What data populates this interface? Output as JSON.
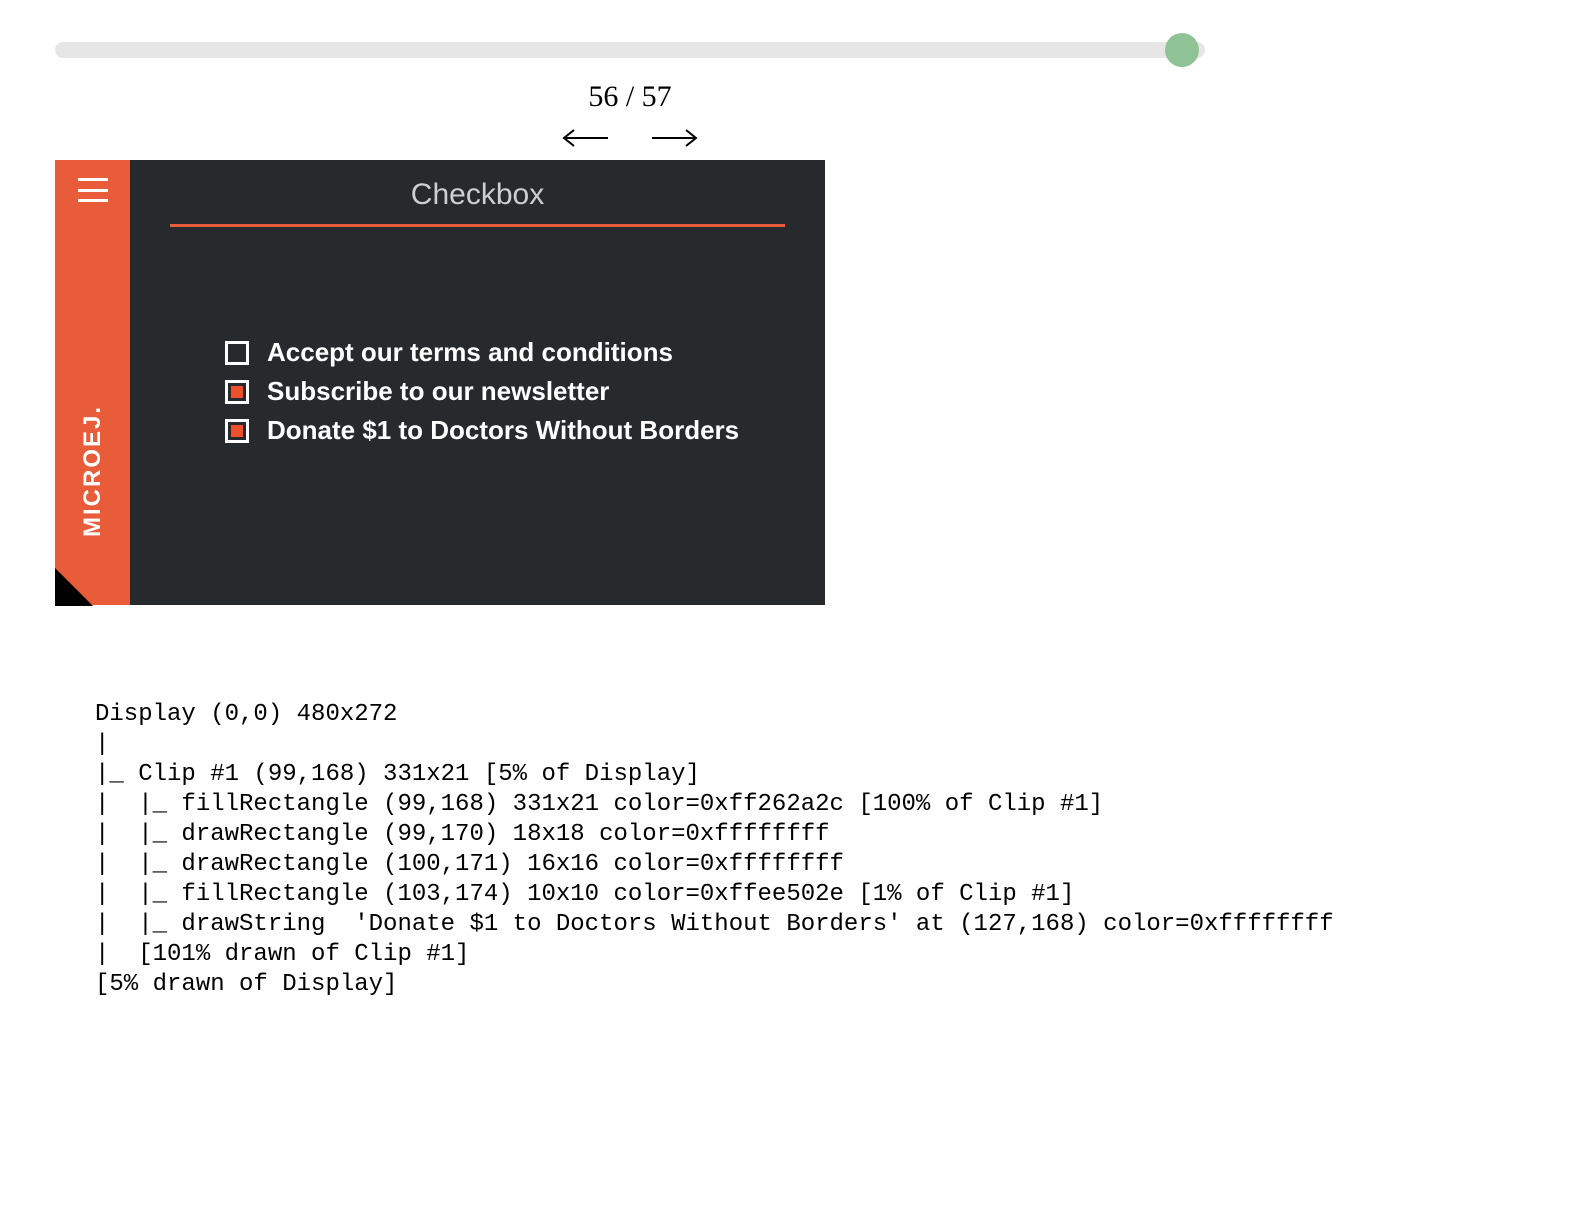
{
  "slider": {
    "position": 56,
    "total": 57
  },
  "counter": "56 / 57",
  "device": {
    "brand": "MICROEJ.",
    "title": "Checkbox",
    "items": [
      {
        "label": "Accept our terms and conditions",
        "checked": false
      },
      {
        "label": "Subscribe to our newsletter",
        "checked": true
      },
      {
        "label": "Donate $1 to Doctors Without Borders",
        "checked": true
      }
    ]
  },
  "trace_lines": [
    "Display (0,0) 480x272",
    "|",
    "|_ Clip #1 (99,168) 331x21 [5% of Display]",
    "|  |_ fillRectangle (99,168) 331x21 color=0xff262a2c [100% of Clip #1]",
    "|  |_ drawRectangle (99,170) 18x18 color=0xffffffff",
    "|  |_ drawRectangle (100,171) 16x16 color=0xffffffff",
    "|  |_ fillRectangle (103,174) 10x10 color=0xffee502e [1% of Clip #1]",
    "|  |_ drawString  'Donate $1 to Doctors Without Borders' at (127,168) color=0xffffffff",
    "|  [101% drawn of Clip #1]",
    "[5% drawn of Display]"
  ]
}
